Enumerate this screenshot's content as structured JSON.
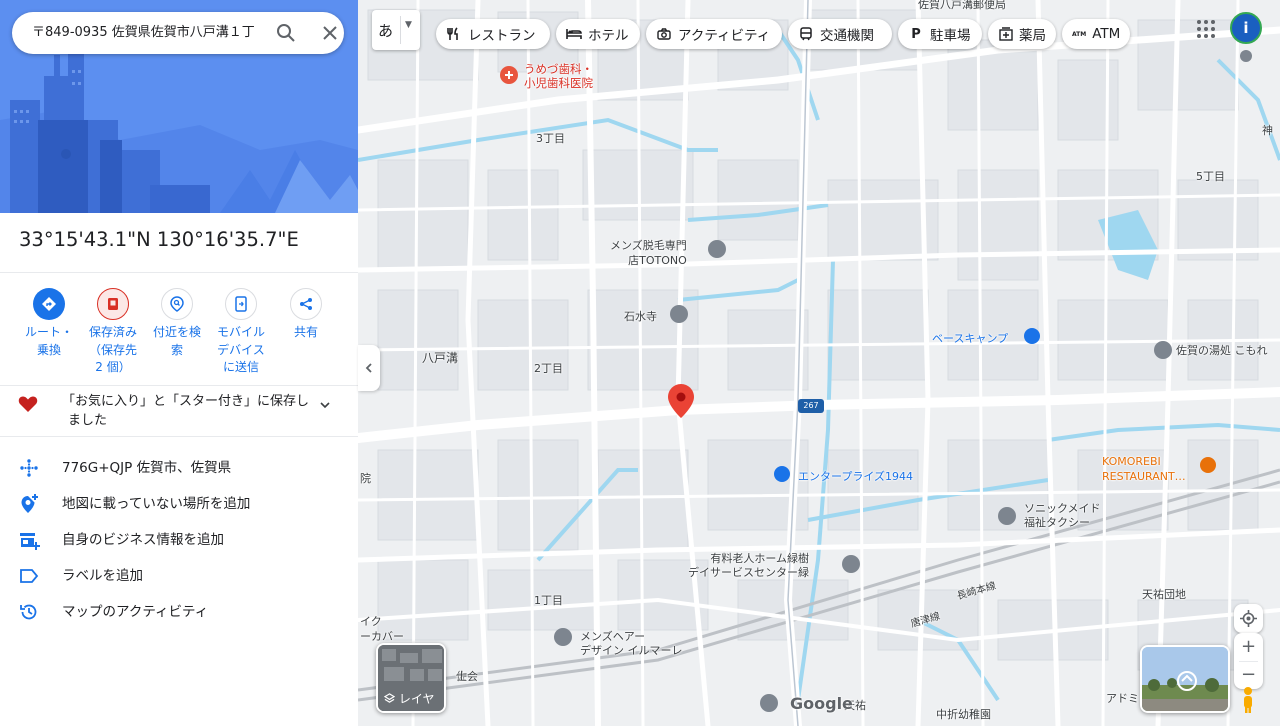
{
  "search": {
    "query": "〒849-0935 佐賀県佐賀市八戸溝１丁"
  },
  "place": {
    "coordinates": "33°15'43.1\"N 130°16'35.7\"E"
  },
  "actions": [
    {
      "label": "ルート・\n乗換",
      "icon": "directions-icon",
      "color": "#1a73e8"
    },
    {
      "label": "保存済み\n（保存先\n2 個）",
      "icon": "bookmark-icon",
      "color": "#d93025"
    },
    {
      "label": "付近を検\n索",
      "icon": "nearby-icon",
      "color": "#1a73e8"
    },
    {
      "label": "モバイル\nデバイス\nに送信",
      "icon": "send-to-phone-icon",
      "color": "#1a73e8"
    },
    {
      "label": "共有",
      "icon": "share-icon",
      "color": "#1a73e8"
    }
  ],
  "saved": {
    "text": "「お気に入り」と「スター付き」に保存しました"
  },
  "info_rows": [
    {
      "text": "776G+QJP 佐賀市、佐賀県",
      "icon": "plus-code-icon"
    },
    {
      "text": "地図に載っていない場所を追加",
      "icon": "add-place-icon"
    },
    {
      "text": "自身のビジネス情報を追加",
      "icon": "add-business-icon"
    },
    {
      "text": "ラベルを追加",
      "icon": "label-icon"
    },
    {
      "text": "マップのアクティビティ",
      "icon": "history-icon"
    }
  ],
  "map": {
    "language_button": "あ",
    "chips": [
      {
        "label": "レストラン",
        "icon": "restaurant-icon"
      },
      {
        "label": "ホテル",
        "icon": "hotel-icon"
      },
      {
        "label": "アクティビティ",
        "icon": "camera-icon"
      },
      {
        "label": "交通機関",
        "icon": "transit-icon"
      },
      {
        "label": "駐車場",
        "icon": "parking-icon"
      },
      {
        "label": "薬局",
        "icon": "pharmacy-icon"
      },
      {
        "label": "ATM",
        "icon": "atm-icon"
      }
    ],
    "avatar_letter": "i",
    "layer_label": "レイヤ",
    "google_logo": "Google",
    "labels": {
      "dental": "うめづ歯科・\n小児歯科医院",
      "chome3": "3丁目",
      "chome5": "5丁目",
      "chome2": "2丁目",
      "chome1": "1丁目",
      "mens_hair_removal": "メンズ脱毛専門\n店TOTONO",
      "sekisuiji": "石水寺",
      "basecamp": "ベースキャンプ",
      "saga_yu": "佐賀の湯処 こもれ",
      "yatomizo": "八戸溝",
      "route": "267",
      "enterprise": "エンタープライズ1944",
      "komorebi": "KOMOREBI\nRESTAURANT…",
      "sonic": "ソニックメイド\n福祉タクシー",
      "nursing": "有料老人ホーム緑樹\nデイサービスセンター緑",
      "nagasaki_line": "長崎本線",
      "karatsu_line": "唐津線",
      "tenyu_danchi": "天祐団地",
      "mens_hair": "メンズヘアー\nデザイン イルマーレ",
      "nakaori": "中折幼稚園",
      "tenyu": "天祐",
      "post": "佐賀八戸溝郵便局",
      "in": "院",
      "cover": "イク\nーカバー",
      "kai": "士会",
      "saga": "佐",
      "adomi": "アドミ",
      "kami": "神"
    }
  }
}
